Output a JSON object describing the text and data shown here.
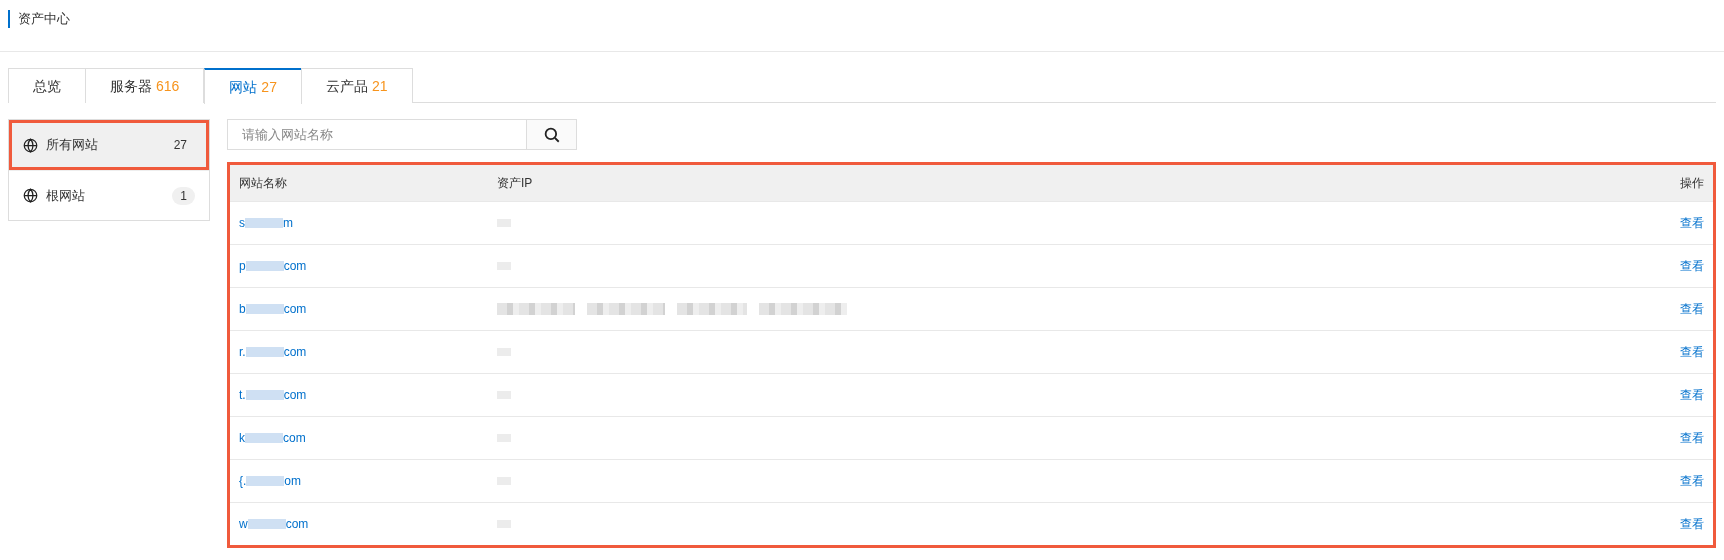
{
  "page": {
    "title": "资产中心"
  },
  "tabs": [
    {
      "label": "总览",
      "selected": false
    },
    {
      "label": "服务器",
      "count": "616",
      "selected": false
    },
    {
      "label": "网站",
      "count": "27",
      "selected": true
    },
    {
      "label": "云产品",
      "count": "21",
      "selected": false
    }
  ],
  "sidebar": {
    "items": [
      {
        "label": "所有网站",
        "count": "27",
        "selected": true,
        "highlighted": true
      },
      {
        "label": "根网站",
        "count": "1",
        "selected": false,
        "highlighted": false
      }
    ]
  },
  "search": {
    "placeholder": "请输入网站名称"
  },
  "table": {
    "highlighted": true,
    "columns": [
      "网站名称",
      "资产IP",
      "操作"
    ],
    "rows": [
      {
        "name_start": "s",
        "name_end": "m",
        "ip": {
          "kind": "short"
        },
        "action": "查看"
      },
      {
        "name_start": "p",
        "name_end": "com",
        "ip": {
          "kind": "short"
        },
        "action": "查看"
      },
      {
        "name_start": "b",
        "name_end": "com",
        "ip": {
          "kind": "long"
        },
        "action": "查看"
      },
      {
        "name_start": "r.",
        "name_end": "com",
        "ip": {
          "kind": "short"
        },
        "action": "查看"
      },
      {
        "name_start": "t.",
        "name_end": "com",
        "ip": {
          "kind": "short"
        },
        "action": "查看"
      },
      {
        "name_start": "k",
        "name_end": "com",
        "ip": {
          "kind": "short"
        },
        "action": "查看"
      },
      {
        "name_start": "{.",
        "name_end": "om",
        "ip": {
          "kind": "short"
        },
        "action": "查看"
      },
      {
        "name_start": "w",
        "name_end": "com",
        "ip": {
          "kind": "short"
        },
        "action": "查看"
      }
    ]
  }
}
